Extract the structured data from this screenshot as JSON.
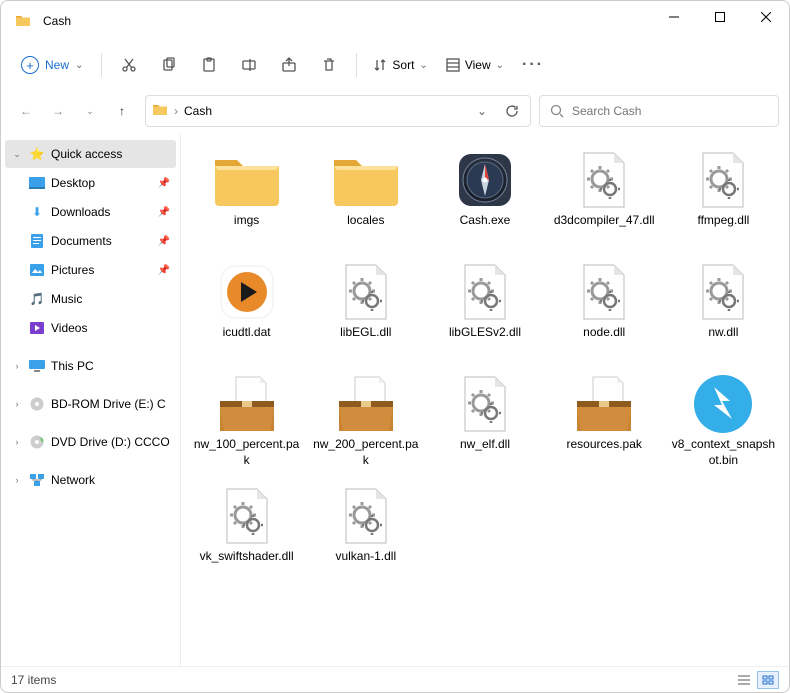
{
  "window": {
    "title": "Cash"
  },
  "toolbar": {
    "new_label": "New",
    "sort_label": "Sort",
    "view_label": "View"
  },
  "breadcrumb": {
    "root": "Cash"
  },
  "search": {
    "placeholder": "Search Cash"
  },
  "sidebar": {
    "quick_access": "Quick access",
    "desktop": "Desktop",
    "downloads": "Downloads",
    "documents": "Documents",
    "pictures": "Pictures",
    "music": "Music",
    "videos": "Videos",
    "this_pc": "This PC",
    "bdrom": "BD-ROM Drive (E:) C",
    "dvd": "DVD Drive (D:) CCCO",
    "network": "Network"
  },
  "files": {
    "imgs": "imgs",
    "locales": "locales",
    "cash_exe": "Cash.exe",
    "d3d": "d3dcompiler_47.dll",
    "ffmpeg": "ffmpeg.dll",
    "icudtl": "icudtl.dat",
    "libegl": "libEGL.dll",
    "libgles": "libGLESv2.dll",
    "node": "node.dll",
    "nw": "nw.dll",
    "nw100": "nw_100_percent.pak",
    "nw200": "nw_200_percent.pak",
    "nwelf": "nw_elf.dll",
    "resources": "resources.pak",
    "v8": "v8_context_snapshot.bin",
    "swiftshader": "vk_swiftshader.dll",
    "vulkan": "vulkan-1.dll"
  },
  "status": {
    "count": "17 items"
  },
  "icons": {
    "cut": "scissors-icon",
    "copy": "copy-icon",
    "paste": "clipboard-icon",
    "rename": "rename-icon",
    "share": "share-icon",
    "delete": "trash-icon",
    "more": "more-icon"
  },
  "colors": {
    "accent": "#1a6fd1",
    "folder": "#f7c85e",
    "folder_dark": "#e5a836"
  }
}
